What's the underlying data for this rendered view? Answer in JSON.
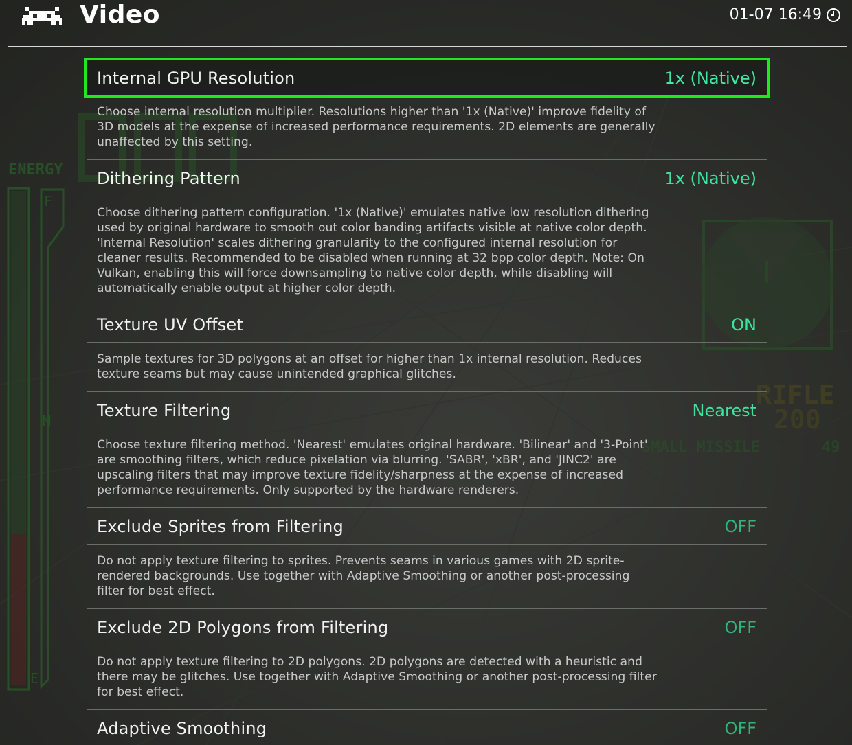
{
  "header": {
    "title": "Video",
    "clock": "01-07 16:49",
    "logo_icon": "retroarch-invader-icon",
    "clock_icon": "clock-icon"
  },
  "colors": {
    "accent_green": "#1ee81e",
    "value_green": "#3ee29e",
    "background": "#2b2d2a"
  },
  "entries": [
    {
      "label": "Internal GPU Resolution",
      "value": "1x (Native)",
      "selected": true,
      "description": "Choose internal resolution multiplier. Resolutions higher than '1x (Native)' improve fidelity of 3D models at the expense of increased performance requirements. 2D elements are generally unaffected by this setting."
    },
    {
      "label": "Dithering Pattern",
      "value": "1x (Native)",
      "selected": false,
      "description": "Choose dithering pattern configuration. '1x (Native)' emulates native low resolution dithering used by original hardware to smooth out color banding artifacts visible at native color depth. 'Internal Resolution' scales dithering granularity to the configured internal resolution for cleaner results. Recommended to be disabled when running at 32 bpp color depth. Note: On Vulkan, enabling this will force downsampling to native color depth, while disabling will automatically enable output at higher color depth."
    },
    {
      "label": "Texture UV Offset",
      "value": "ON",
      "selected": false,
      "description": "Sample textures for 3D polygons at an offset for higher than 1x internal resolution. Reduces texture seams but may cause unintended graphical glitches."
    },
    {
      "label": "Texture Filtering",
      "value": "Nearest",
      "selected": false,
      "description": "Choose texture filtering method. 'Nearest' emulates original hardware. 'Bilinear' and '3-Point' are smoothing filters, which reduce pixelation via blurring. 'SABR', 'xBR', and 'JINC2' are upscaling filters that may improve texture fidelity/sharpness at the expense of increased performance requirements. Only supported by the hardware renderers."
    },
    {
      "label": "Exclude Sprites from Filtering",
      "value": "OFF",
      "selected": false,
      "description": "Do not apply texture filtering to sprites. Prevents seams in various games with 2D sprite-rendered backgrounds. Use together with Adaptive Smoothing or another post-processing filter for best effect."
    },
    {
      "label": "Exclude 2D Polygons from Filtering",
      "value": "OFF",
      "selected": false,
      "description": "Do not apply texture filtering to 2D polygons. 2D polygons are detected with a heuristic and there may be glitches. Use together with Adaptive Smoothing or another post-processing filter for best effect."
    },
    {
      "label": "Adaptive Smoothing",
      "value": "OFF",
      "selected": false,
      "description": ""
    }
  ],
  "background_hud": {
    "energy_label": "ENERGY",
    "weapon_label": "RIFLE",
    "weapon_ammo": "200",
    "secondary_label": "SMALL MISSILE",
    "secondary_ammo": "49",
    "gauge_full": "F",
    "gauge_mid": "M",
    "gauge_empty": "E"
  }
}
